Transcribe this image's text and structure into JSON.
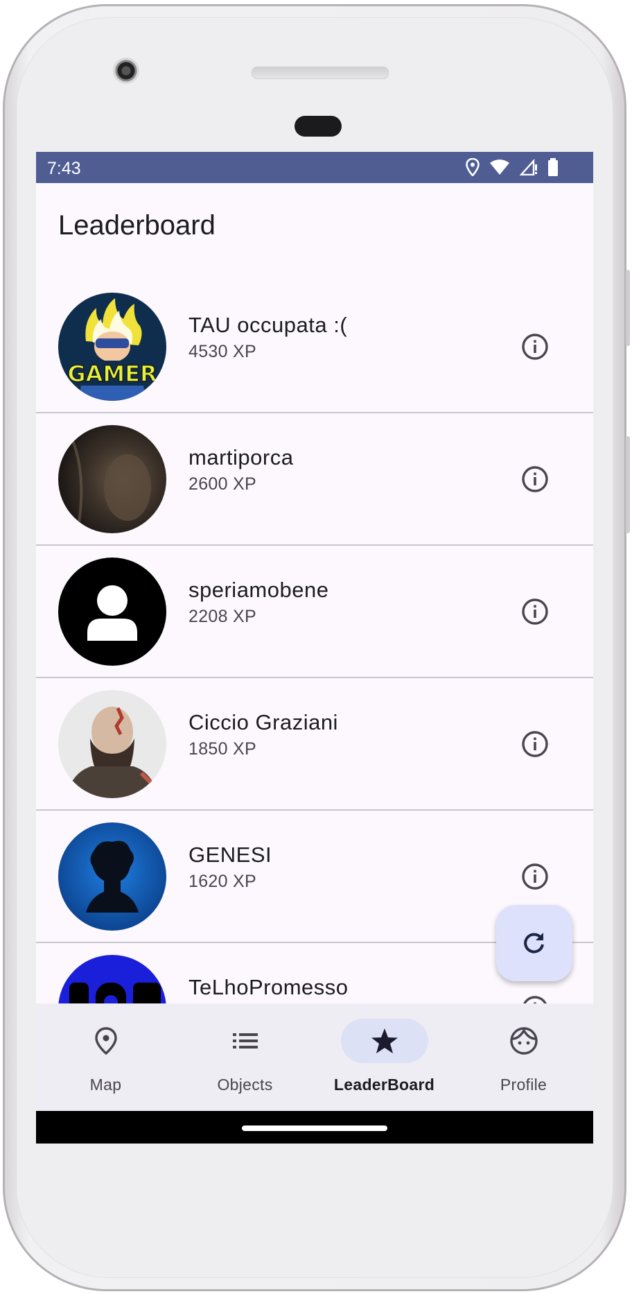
{
  "status_bar": {
    "time": "7:43",
    "icons": [
      "location-icon",
      "wifi-icon",
      "signal-icon",
      "battery-icon"
    ]
  },
  "app": {
    "title": "Leaderboard"
  },
  "leaderboard": [
    {
      "name": "TAU occupata :(",
      "xp": "4530 XP",
      "avatar": "gamer-avatar",
      "avatar_text": "GAMER",
      "info_icon": "info-icon"
    },
    {
      "name": "martiporca",
      "xp": "2600 XP",
      "avatar": "dark-photo-avatar",
      "info_icon": "info-icon"
    },
    {
      "name": "speriamobene",
      "xp": "2208 XP",
      "avatar": "default-person-avatar",
      "info_icon": "info-icon"
    },
    {
      "name": "Ciccio Graziani",
      "xp": "1850 XP",
      "avatar": "bearded-man-avatar",
      "info_icon": "info-icon"
    },
    {
      "name": "GENESI",
      "xp": "1620 XP",
      "avatar": "blue-album-avatar",
      "info_icon": "info-icon"
    },
    {
      "name": "TeLhoPromesso",
      "xp": "",
      "avatar": "blue-text-avatar",
      "info_icon": "info-icon"
    }
  ],
  "fab": {
    "icon": "refresh-icon"
  },
  "nav": [
    {
      "label": "Map",
      "icon": "map-pin-icon",
      "active": false
    },
    {
      "label": "Objects",
      "icon": "list-icon",
      "active": false
    },
    {
      "label": "LeaderBoard",
      "icon": "star-icon",
      "active": true
    },
    {
      "label": "Profile",
      "icon": "face-icon",
      "active": false
    }
  ],
  "colors": {
    "status_bar": "#4f5d93",
    "background": "#fcf8fd",
    "nav_bar": "#efedf4",
    "active_pill": "#dde1f5",
    "fab": "#dde1fb"
  }
}
